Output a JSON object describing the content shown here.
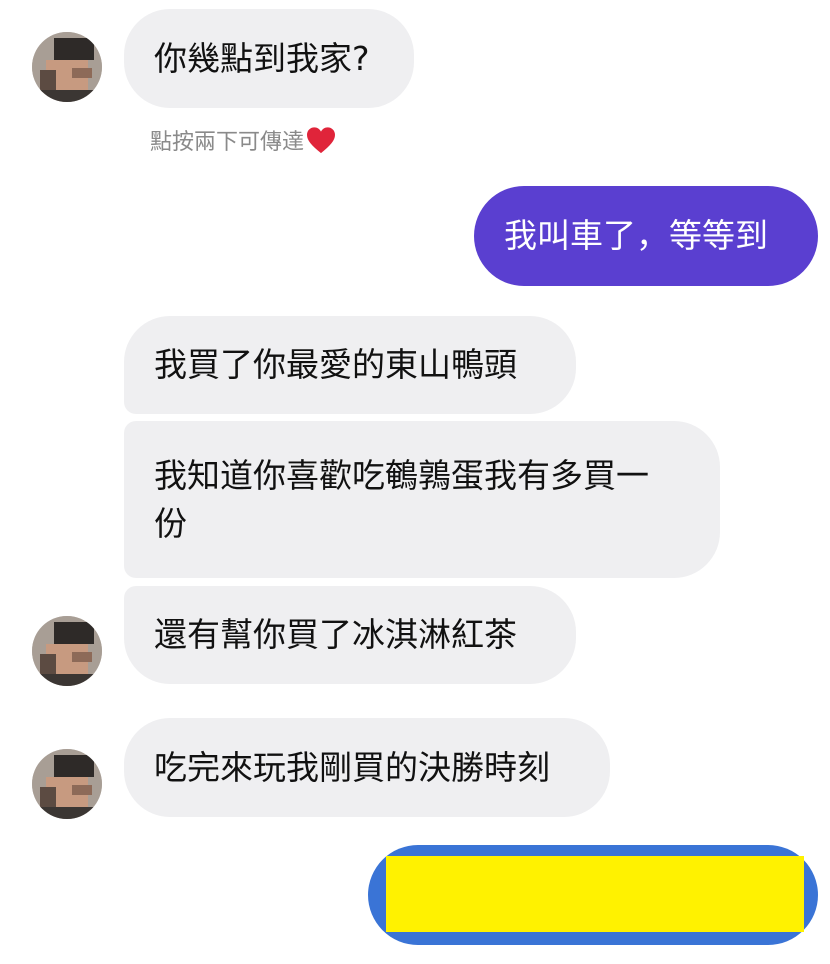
{
  "messages": [
    {
      "id": "m1",
      "direction": "incoming",
      "text": "你幾點到我家?"
    },
    {
      "id": "m2",
      "direction": "outgoing",
      "text": "我叫車了，等等到"
    },
    {
      "id": "m3",
      "direction": "incoming",
      "text": "我買了你最愛的東山鴨頭"
    },
    {
      "id": "m4",
      "direction": "incoming",
      "text_line1": "我知道你喜歡吃鵪鶉蛋我有多買一",
      "text_line2": "份"
    },
    {
      "id": "m5",
      "direction": "incoming",
      "text": "還有幫你買了冰淇淋紅茶"
    },
    {
      "id": "m6",
      "direction": "incoming",
      "text": "吃完來玩我剛買的決勝時刻"
    }
  ],
  "double_tap_hint": "點按兩下可傳達",
  "icons": {
    "reaction": "heart-icon",
    "avatar": "pixelated-profile-photo"
  },
  "colors": {
    "incoming_bubble": "#efeff1",
    "outgoing_bubble": "#5a3fd0",
    "redaction_fill": "#fff200",
    "redaction_border": "#3a74d6",
    "heart": "#e0243a"
  }
}
